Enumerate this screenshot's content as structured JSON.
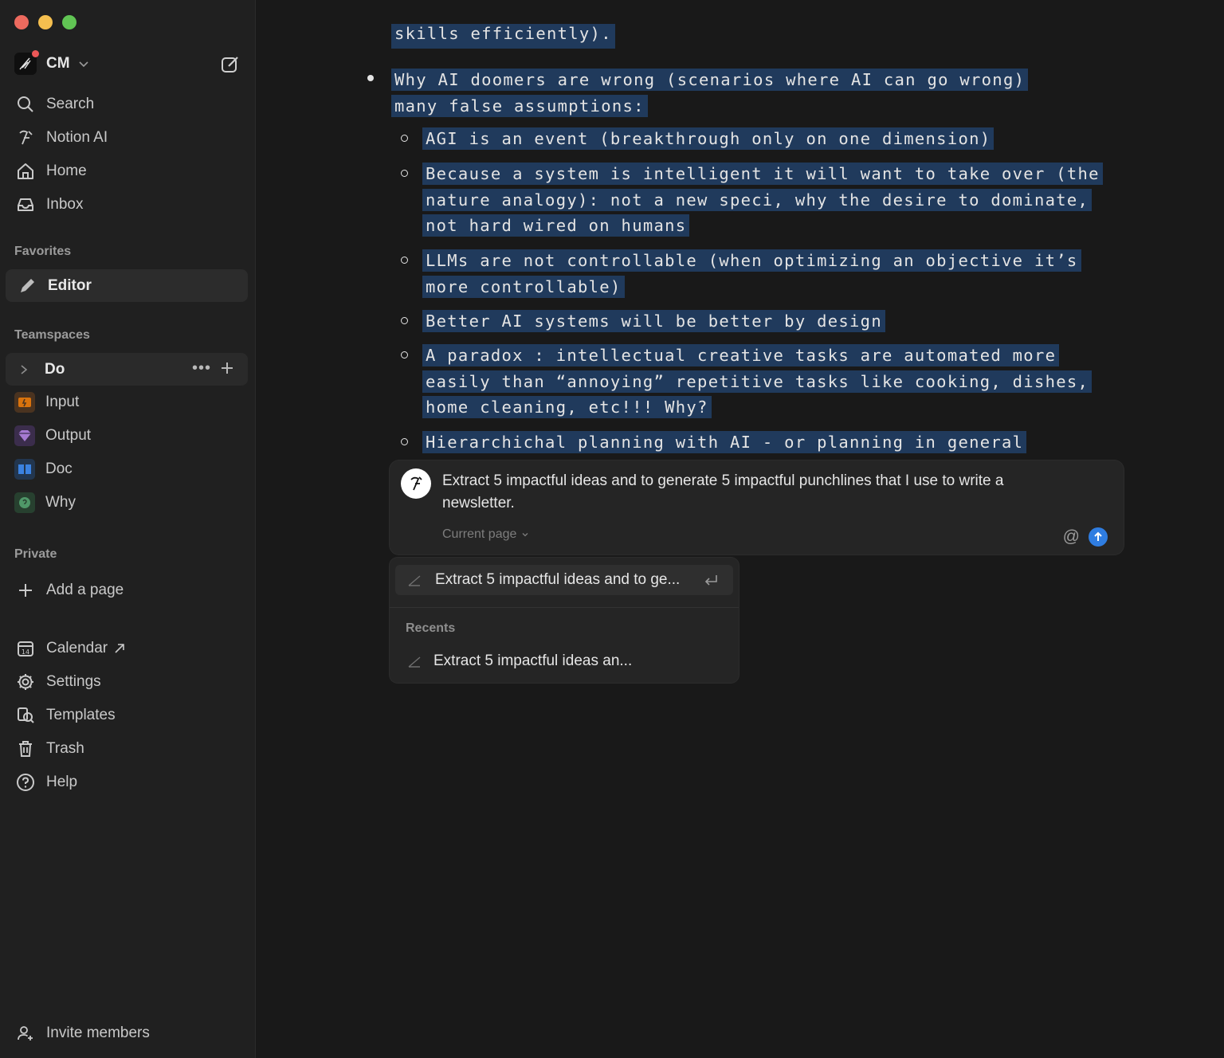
{
  "window": {
    "controls": [
      "close",
      "minimize",
      "zoom"
    ]
  },
  "sidebar": {
    "workspace": {
      "name": "CM"
    },
    "nav": [
      {
        "label": "Search",
        "icon": "search-icon"
      },
      {
        "label": "Notion AI",
        "icon": "notion-ai-icon"
      },
      {
        "label": "Home",
        "icon": "home-icon"
      },
      {
        "label": "Inbox",
        "icon": "inbox-icon"
      }
    ],
    "favorites_label": "Favorites",
    "favorites": [
      {
        "label": "Editor",
        "icon": "pencil-icon"
      }
    ],
    "teamspaces_label": "Teamspaces",
    "teamspace": {
      "label": "Do",
      "more": "•••"
    },
    "pages": [
      {
        "label": "Input",
        "icon": "input-icon",
        "color": "#d9730d"
      },
      {
        "label": "Output",
        "icon": "gem-icon",
        "color": "#9065b0"
      },
      {
        "label": "Doc",
        "icon": "book-icon",
        "color": "#2e77d0"
      },
      {
        "label": "Why",
        "icon": "why-icon",
        "color": "#4f9768"
      }
    ],
    "private_label": "Private",
    "add_page": "Add a page",
    "bottom": [
      {
        "label": "Calendar",
        "icon": "calendar-icon",
        "badge": "14"
      },
      {
        "label": "Settings",
        "icon": "settings-icon"
      },
      {
        "label": "Templates",
        "icon": "templates-icon"
      },
      {
        "label": "Trash",
        "icon": "trash-icon"
      },
      {
        "label": "Help",
        "icon": "help-icon"
      }
    ],
    "invite": "Invite members"
  },
  "document": {
    "cut_line": "skills efficiently).",
    "bullet": "Why AI doomers are wrong (scenarios where AI can go wrong) many false assumptions:",
    "sub_bullets": [
      "AGI is an event (breakthrough only on one dimension)",
      "Because a system is intelligent it will want to take over (the nature analogy): not a new speci, why the desire to dominate, not hard wired on humans",
      "LLMs are not controllable (when optimizing an objective it’s more controllable)",
      "Better AI systems will be better by design",
      "A paradox : intellectual creative tasks are automated more easily than “annoying” repetitive tasks like cooking, dishes, home cleaning, etc!!! Why?",
      "Hierarchichal planning with AI - or planning in general"
    ],
    "highlight_color": "#203a5c"
  },
  "ai_prompt": {
    "text": "Extract 5 impactful ideas and to generate 5 impactful punchlines that I use to write a newsletter.",
    "scope": "Current page",
    "at": "@",
    "accent": "#2f7de1"
  },
  "dropdown": {
    "suggestion": "Extract 5 impactful ideas and to ge...",
    "recents_label": "Recents",
    "recents": [
      "Extract 5 impactful ideas an..."
    ]
  }
}
